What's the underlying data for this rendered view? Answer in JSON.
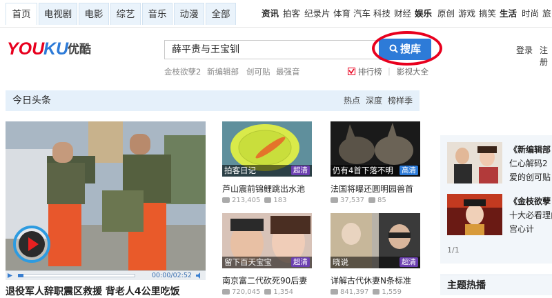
{
  "nav": {
    "tabs": [
      "首页",
      "电视剧",
      "电影",
      "综艺",
      "音乐",
      "动漫",
      "全部"
    ],
    "categories": [
      "资讯",
      "拍客",
      "纪录片",
      "体育",
      "汽车",
      "科技",
      "财经",
      "娱乐",
      "原创",
      "游戏",
      "搞笑",
      "生活",
      "时尚",
      "旅"
    ]
  },
  "header": {
    "logo_text": "YOUKU优酷",
    "search_value": "薛平贵与王宝钏",
    "search_button": "搜库",
    "hot_words": [
      "金枝欲孽2",
      "新编辑部",
      "创可贴",
      "最强音"
    ],
    "ranking": "排行榜",
    "all_videos": "影视大全",
    "login": "登录",
    "register": "注册"
  },
  "section": {
    "title": "今日头条",
    "tabs": [
      "热点",
      "深度",
      "榜样季"
    ]
  },
  "feature": {
    "caption": "退役军人辞职震区救援 背老人4公里吃饭",
    "time": "00:00/02:52"
  },
  "videos": [
    {
      "label": "拍客日记",
      "badge": "超清",
      "title": "芦山震前锦鲤跳出水池",
      "plays": "213,405",
      "comments": "183"
    },
    {
      "label": "仍有4首下落不明",
      "badge": "高清",
      "title": "法国将曝还圆明园兽首",
      "plays": "37,537",
      "comments": "85"
    },
    {
      "label": "留下百天宝宝",
      "badge": "超清",
      "title": "南京富二代砍死90后妻",
      "plays": "720,045",
      "comments": "1,354"
    },
    {
      "label": "晓说",
      "badge": "超清",
      "title": "详解古代休妻N条标准",
      "plays": "841,397",
      "comments": "1,559"
    }
  ],
  "side": {
    "items": [
      {
        "title": "《新编辑部",
        "sub1": "仁心解码2",
        "sub2": "爱的创可贴"
      },
      {
        "title": "《金枝欲孽",
        "sub1": "十大必看理由",
        "sub2": "宫心计"
      }
    ],
    "pager": "1/1",
    "section_title": "主题热播"
  }
}
